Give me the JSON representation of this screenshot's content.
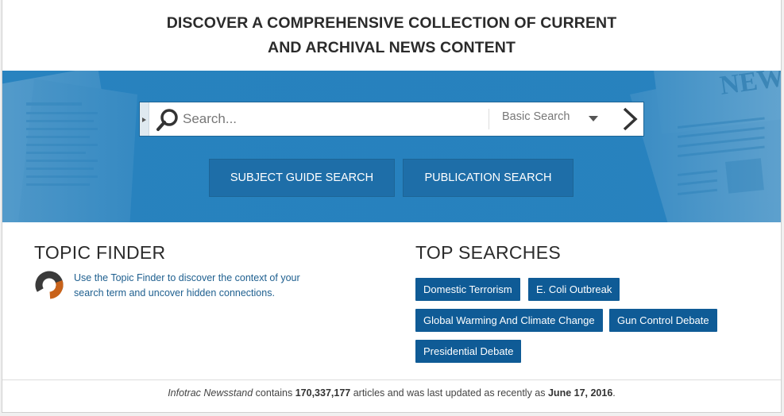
{
  "headline": {
    "line1": "DISCOVER A COMPREHENSIVE COLLECTION OF CURRENT",
    "line2": "AND ARCHIVAL NEWS CONTENT"
  },
  "search": {
    "placeholder": "Search...",
    "mode": "Basic Search",
    "icons": {
      "search": "magnifier-icon",
      "submit": "chevron-right-icon",
      "toggle": "triangle-right-icon",
      "dropdown": "caret-down-icon"
    }
  },
  "buttons": {
    "subject_guide": "SUBJECT GUIDE SEARCH",
    "publication": "PUBLICATION SEARCH"
  },
  "topic_finder": {
    "title": "TOPIC FINDER",
    "description": "Use the Topic Finder to discover the context of your search term and uncover hidden connections."
  },
  "top_searches": {
    "title": "TOP SEARCHES",
    "items": [
      "Domestic Terrorism",
      "E. Coli Outbreak",
      "Global Warming And Climate Change",
      "Gun Control Debate",
      "Presidential Debate"
    ]
  },
  "footer": {
    "product": "Infotrac Newsstand",
    "contains": " contains ",
    "count": "170,337,177",
    "middle": " articles and was last updated as recently as ",
    "date": "June 17, 2016",
    "end": "."
  },
  "colors": {
    "hero": "#2a86c1",
    "chip": "#0f5b96",
    "link": "#1e5f8f"
  }
}
